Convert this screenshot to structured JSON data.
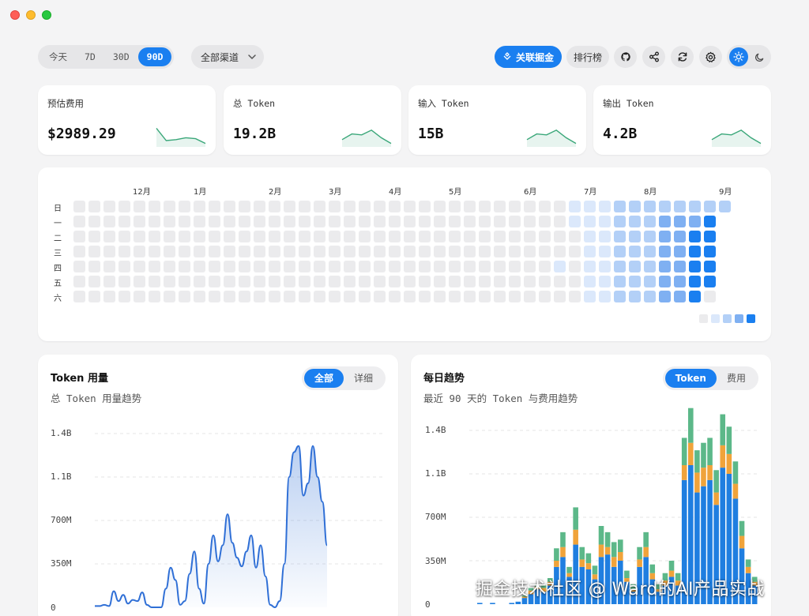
{
  "toolbar": {
    "ranges": [
      "今天",
      "7D",
      "30D",
      "90D"
    ],
    "active_range": "90D",
    "channel": "全部渠道",
    "juejin_label": "关联掘金",
    "rank_label": "排行榜",
    "icons": [
      "github-icon",
      "share-icon",
      "refresh-icon",
      "settings-icon",
      "sun-icon",
      "moon-icon"
    ]
  },
  "stats": [
    {
      "label": "预估费用",
      "value": "$2989.29",
      "trend": [
        0.9,
        0.25,
        0.3,
        0.4,
        0.35,
        0.1
      ],
      "color": "#3aa779"
    },
    {
      "label": "总 Token",
      "value": "19.2B",
      "trend": [
        0.3,
        0.6,
        0.55,
        0.8,
        0.4,
        0.1
      ],
      "color": "#3aa779"
    },
    {
      "label": "输入 Token",
      "value": "15B",
      "trend": [
        0.3,
        0.6,
        0.55,
        0.8,
        0.4,
        0.1
      ],
      "color": "#3aa779"
    },
    {
      "label": "输出 Token",
      "value": "4.2B",
      "trend": [
        0.3,
        0.6,
        0.55,
        0.8,
        0.4,
        0.1
      ],
      "color": "#3aa779"
    }
  ],
  "heatmap": {
    "months": [
      "12月",
      "1月",
      "2月",
      "3月",
      "4月",
      "5月",
      "6月",
      "7月",
      "8月",
      "9月"
    ],
    "days": [
      "日",
      "一",
      "二",
      "三",
      "四",
      "五",
      "六"
    ],
    "levels_colors": [
      "#ebebed",
      "#dbe8fb",
      "#b3d0f7",
      "#7fb0f2",
      "#1a7ff0"
    ],
    "level_counts": {
      "note": "intensity per cell 0-4, by week column"
    }
  },
  "token_panel": {
    "title": "Token 用量",
    "subtitle": "总 Token 用量趋势",
    "tabs": [
      "全部",
      "详细"
    ],
    "active_tab": "全部",
    "yticks": [
      "1.4B",
      "1.1B",
      "700M",
      "350M",
      "0"
    ]
  },
  "daily_panel": {
    "title": "每日趋势",
    "subtitle": "最近 90 天的 Token 与费用趋势",
    "tabs": [
      "Token",
      "费用"
    ],
    "active_tab": "Token",
    "yticks": [
      "1.4B",
      "1.1B",
      "700M",
      "350M",
      "0"
    ]
  },
  "chart_data": [
    {
      "type": "area",
      "title": "Token 用量",
      "ylim": [
        0,
        1400000000
      ],
      "series": [
        {
          "values": [
            0.01,
            0.01,
            0.02,
            0.01,
            0.13,
            0.05,
            0.1,
            0.03,
            0.06,
            0.05,
            0.12,
            0.02,
            0.0,
            0.0,
            0.0,
            0.15,
            0.32,
            0.22,
            0.02,
            0.05,
            0.27,
            0.45,
            0.15,
            0.03,
            0.35,
            0.58,
            0.37,
            0.5,
            0.75,
            0.52,
            0.4,
            0.33,
            0.45,
            0.58,
            0.32,
            0.5,
            0.25,
            0.02,
            0.0,
            0.05,
            0.35,
            1.05,
            1.25,
            1.3,
            0.9,
            1.0,
            1.3,
            1.05,
            0.85,
            0.5
          ]
        }
      ]
    },
    {
      "type": "bar",
      "title": "每日趋势",
      "ylim": [
        0,
        1400000000
      ],
      "series": [
        {
          "values": [
            0.01,
            0.0,
            0.01,
            0.0,
            0.0,
            0.01,
            0.02,
            0.05,
            0.08,
            0.12,
            0.1,
            0.15,
            0.3,
            0.38,
            0.22,
            0.48,
            0.3,
            0.28,
            0.2,
            0.38,
            0.4,
            0.3,
            0.35,
            0.18,
            0.1,
            0.3,
            0.38,
            0.2,
            0.1,
            0.15,
            0.22,
            0.15,
            1.0,
            1.12,
            0.9,
            0.95,
            1.0,
            0.8,
            1.1,
            1.05,
            0.85,
            0.45,
            0.25,
            0.15
          ]
        },
        {
          "values": [
            0.0,
            0.0,
            0.0,
            0.0,
            0.0,
            0.0,
            0.0,
            0.01,
            0.03,
            0.02,
            0.03,
            0.03,
            0.05,
            0.08,
            0.03,
            0.12,
            0.06,
            0.05,
            0.04,
            0.1,
            0.06,
            0.08,
            0.07,
            0.03,
            0.02,
            0.06,
            0.08,
            0.05,
            0.02,
            0.04,
            0.05,
            0.04,
            0.12,
            0.18,
            0.16,
            0.15,
            0.12,
            0.1,
            0.18,
            0.16,
            0.12,
            0.1,
            0.05,
            0.03
          ]
        },
        {
          "values": [
            0.0,
            0.0,
            0.0,
            0.0,
            0.0,
            0.0,
            0.0,
            0.01,
            0.02,
            0.02,
            0.02,
            0.03,
            0.1,
            0.12,
            0.05,
            0.18,
            0.1,
            0.08,
            0.07,
            0.15,
            0.12,
            0.12,
            0.1,
            0.06,
            0.04,
            0.1,
            0.12,
            0.07,
            0.04,
            0.06,
            0.08,
            0.06,
            0.22,
            0.28,
            0.18,
            0.2,
            0.22,
            0.18,
            0.25,
            0.22,
            0.18,
            0.12,
            0.06,
            0.04
          ]
        }
      ]
    }
  ],
  "watermark": "掘金技术社区 @ Ward的AI产品实战"
}
